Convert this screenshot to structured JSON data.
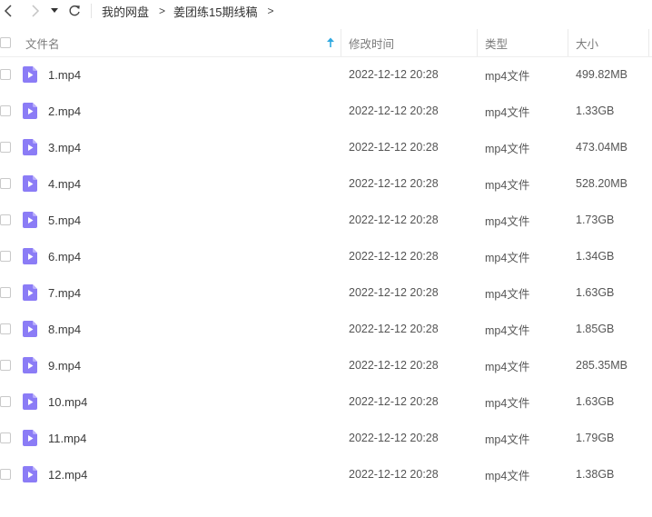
{
  "toolbar": {
    "back_icon": "chevron-left-icon",
    "forward_icon": "chevron-right-icon",
    "history_icon": "caret-down-icon",
    "refresh_icon": "refresh-icon"
  },
  "breadcrumb": [
    {
      "label": "我的网盘"
    },
    {
      "label": "姜团练15期线稿"
    }
  ],
  "header": {
    "name": "文件名",
    "modified": "修改时间",
    "type": "类型",
    "size": "大小",
    "sort_icon": "sort-ascending-arrow-icon"
  },
  "colors": {
    "accent": "#2fa8e0",
    "file_icon": "#8b7cf6"
  },
  "files": [
    {
      "name": "1.mp4",
      "modified": "2022-12-12 20:28",
      "type": "mp4文件",
      "size": "499.82MB"
    },
    {
      "name": "2.mp4",
      "modified": "2022-12-12 20:28",
      "type": "mp4文件",
      "size": "1.33GB"
    },
    {
      "name": "3.mp4",
      "modified": "2022-12-12 20:28",
      "type": "mp4文件",
      "size": "473.04MB"
    },
    {
      "name": "4.mp4",
      "modified": "2022-12-12 20:28",
      "type": "mp4文件",
      "size": "528.20MB"
    },
    {
      "name": "5.mp4",
      "modified": "2022-12-12 20:28",
      "type": "mp4文件",
      "size": "1.73GB"
    },
    {
      "name": "6.mp4",
      "modified": "2022-12-12 20:28",
      "type": "mp4文件",
      "size": "1.34GB"
    },
    {
      "name": "7.mp4",
      "modified": "2022-12-12 20:28",
      "type": "mp4文件",
      "size": "1.63GB"
    },
    {
      "name": "8.mp4",
      "modified": "2022-12-12 20:28",
      "type": "mp4文件",
      "size": "1.85GB"
    },
    {
      "name": "9.mp4",
      "modified": "2022-12-12 20:28",
      "type": "mp4文件",
      "size": "285.35MB"
    },
    {
      "name": "10.mp4",
      "modified": "2022-12-12 20:28",
      "type": "mp4文件",
      "size": "1.63GB"
    },
    {
      "name": "11.mp4",
      "modified": "2022-12-12 20:28",
      "type": "mp4文件",
      "size": "1.79GB"
    },
    {
      "name": "12.mp4",
      "modified": "2022-12-12 20:28",
      "type": "mp4文件",
      "size": "1.38GB"
    }
  ]
}
